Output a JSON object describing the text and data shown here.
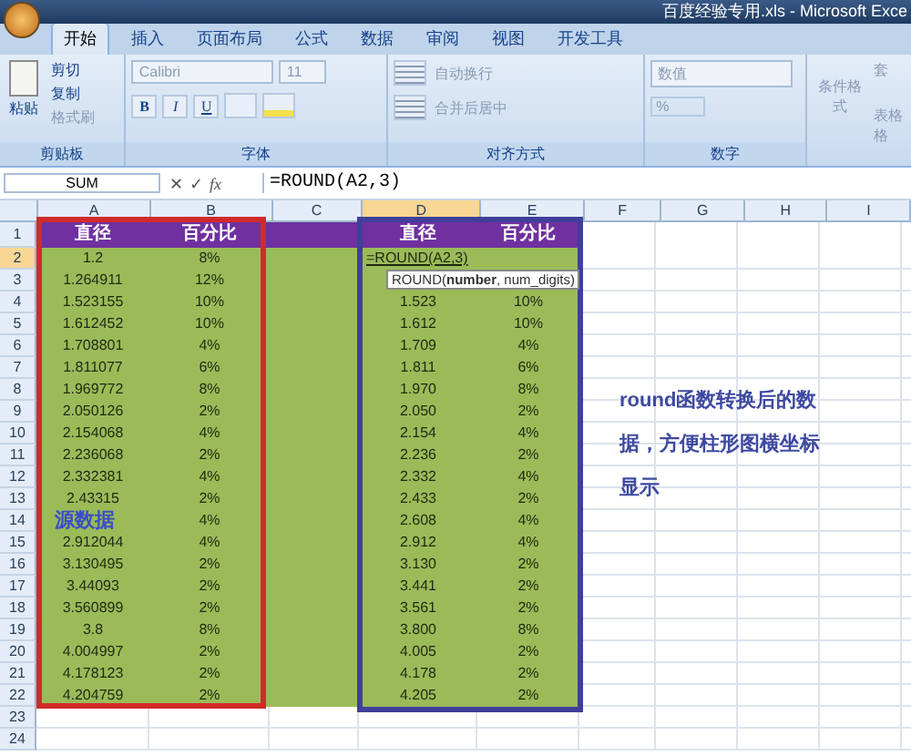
{
  "window": {
    "title": "百度经验专用.xls - Microsoft Exce"
  },
  "tabs": [
    {
      "label": "开始",
      "selected": true
    },
    {
      "label": "插入",
      "selected": false
    },
    {
      "label": "页面布局",
      "selected": false
    },
    {
      "label": "公式",
      "selected": false
    },
    {
      "label": "数据",
      "selected": false
    },
    {
      "label": "审阅",
      "selected": false
    },
    {
      "label": "视图",
      "selected": false
    },
    {
      "label": "开发工具",
      "selected": false
    }
  ],
  "ribbon": {
    "clipboard": {
      "label": "剪贴板",
      "paste": "粘贴",
      "cut": "剪切",
      "copy": "复制",
      "format_painter": "格式刷"
    },
    "font": {
      "label": "字体",
      "name": "Calibri",
      "size": "11",
      "bold": "B",
      "italic": "I",
      "underline": "U"
    },
    "alignment": {
      "label": "对齐方式",
      "wrap": "自动换行",
      "merge": "合并后居中"
    },
    "number": {
      "label": "数字",
      "format": "数值",
      "percent": "%"
    },
    "styles": {
      "conditional": "条件格式",
      "table_1": "套",
      "table_2": "表格格"
    }
  },
  "formula_bar": {
    "name_box": "SUM",
    "cancel": "✕",
    "enter": "✓",
    "fx": "fx",
    "formula": "=ROUND(A2,3)"
  },
  "columns": [
    {
      "label": "A",
      "selected": false
    },
    {
      "label": "B",
      "selected": false
    },
    {
      "label": "C",
      "selected": false
    },
    {
      "label": "D",
      "selected": true
    },
    {
      "label": "E",
      "selected": false
    },
    {
      "label": "F",
      "selected": false
    },
    {
      "label": "G",
      "selected": false
    },
    {
      "label": "H",
      "selected": false
    },
    {
      "label": "I",
      "selected": false
    }
  ],
  "rows": [
    {
      "n": "1",
      "selected": false,
      "kind": "header",
      "a": "直径",
      "b": "百分比",
      "d": "直径",
      "e": "百分比"
    },
    {
      "n": "2",
      "selected": true,
      "kind": "data",
      "a": "1.2",
      "b": "8%",
      "d": "=ROUND(A2,3)"
    },
    {
      "n": "3",
      "selected": false,
      "kind": "data",
      "a": "1.264911",
      "b": "12%"
    },
    {
      "n": "4",
      "selected": false,
      "kind": "data",
      "a": "1.523155",
      "b": "10%",
      "d": "1.523",
      "e": "10%"
    },
    {
      "n": "5",
      "selected": false,
      "kind": "data",
      "a": "1.612452",
      "b": "10%",
      "d": "1.612",
      "e": "10%"
    },
    {
      "n": "6",
      "selected": false,
      "kind": "data",
      "a": "1.708801",
      "b": "4%",
      "d": "1.709",
      "e": "4%"
    },
    {
      "n": "7",
      "selected": false,
      "kind": "data",
      "a": "1.811077",
      "b": "6%",
      "d": "1.811",
      "e": "6%"
    },
    {
      "n": "8",
      "selected": false,
      "kind": "data",
      "a": "1.969772",
      "b": "8%",
      "d": "1.970",
      "e": "8%"
    },
    {
      "n": "9",
      "selected": false,
      "kind": "data",
      "a": "2.050126",
      "b": "2%",
      "d": "2.050",
      "e": "2%"
    },
    {
      "n": "10",
      "selected": false,
      "kind": "data",
      "a": "2.154068",
      "b": "4%",
      "d": "2.154",
      "e": "4%"
    },
    {
      "n": "11",
      "selected": false,
      "kind": "data",
      "a": "2.236068",
      "b": "2%",
      "d": "2.236",
      "e": "2%"
    },
    {
      "n": "12",
      "selected": false,
      "kind": "data",
      "a": "2.332381",
      "b": "4%",
      "d": "2.332",
      "e": "4%"
    },
    {
      "n": "13",
      "selected": false,
      "kind": "data",
      "a": "2.43315",
      "b": "2%",
      "d": "2.433",
      "e": "2%"
    },
    {
      "n": "14",
      "selected": false,
      "kind": "data",
      "a_label": "源数据",
      "b": "4%",
      "d": "2.608",
      "e": "4%"
    },
    {
      "n": "15",
      "selected": false,
      "kind": "data",
      "a": "2.912044",
      "b": "4%",
      "d": "2.912",
      "e": "4%"
    },
    {
      "n": "16",
      "selected": false,
      "kind": "data",
      "a": "3.130495",
      "b": "2%",
      "d": "3.130",
      "e": "2%"
    },
    {
      "n": "17",
      "selected": false,
      "kind": "data",
      "a": "3.44093",
      "b": "2%",
      "d": "3.441",
      "e": "2%"
    },
    {
      "n": "18",
      "selected": false,
      "kind": "data",
      "a": "3.560899",
      "b": "2%",
      "d": "3.561",
      "e": "2%"
    },
    {
      "n": "19",
      "selected": false,
      "kind": "data",
      "a": "3.8",
      "b": "8%",
      "d": "3.800",
      "e": "8%"
    },
    {
      "n": "20",
      "selected": false,
      "kind": "data",
      "a": "4.004997",
      "b": "2%",
      "d": "4.005",
      "e": "2%"
    },
    {
      "n": "21",
      "selected": false,
      "kind": "data",
      "a": "4.178123",
      "b": "2%",
      "d": "4.178",
      "e": "2%"
    },
    {
      "n": "22",
      "selected": false,
      "kind": "data",
      "a": "4.204759",
      "b": "2%",
      "d": "4.205",
      "e": "2%"
    },
    {
      "n": "23",
      "selected": false,
      "kind": "empty"
    },
    {
      "n": "24",
      "selected": false,
      "kind": "empty"
    }
  ],
  "tooltip": "ROUND(**number**, num_digits)",
  "annotations": {
    "note": "round函数转换后的数据，方便柱形图横坐标显示"
  }
}
